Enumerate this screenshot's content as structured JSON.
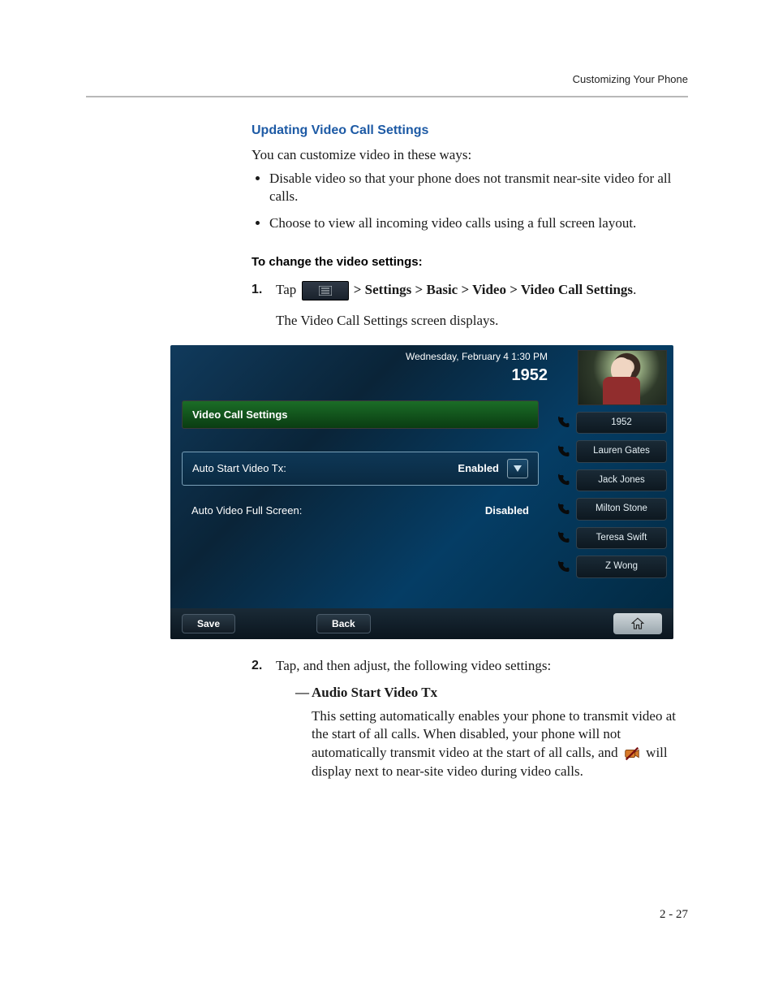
{
  "header": {
    "running": "Customizing Your Phone"
  },
  "section": {
    "title": "Updating Video Call Settings",
    "intro": "You can customize video in these ways:",
    "bullets": [
      "Disable video so that your phone does not transmit near-site video for all calls.",
      "Choose to view all incoming video calls using a full screen layout."
    ],
    "subTitle": "To change the video settings:",
    "step1_prefix": "Tap ",
    "step1_suffix_bold": "  > Settings > Basic > Video > Video Call Settings",
    "step1_period": ".",
    "step1_after": "The Video Call Settings screen displays.",
    "step2_intro": "Tap, and then adjust, the following video settings:",
    "step2_sub_bold": "Audio Start Video Tx",
    "step2_sub_body_1": "This setting automatically enables your phone to transmit video at the start of all calls. When disabled, your phone will not automatically transmit video at the start of all calls, and ",
    "step2_sub_body_2": " will display next to near-site video during video calls."
  },
  "phone": {
    "date": "Wednesday, February 4  1:30 PM",
    "extension": "1952",
    "panelTitle": "Video Call Settings",
    "settings": [
      {
        "label": "Auto Start Video Tx:",
        "value": "Enabled",
        "selected": true,
        "hasDropdown": true
      },
      {
        "label": "Auto Video Full Screen:",
        "value": "Disabled",
        "selected": false,
        "hasDropdown": false
      }
    ],
    "softkeys": {
      "save": "Save",
      "back": "Back"
    },
    "contacts": [
      "1952",
      "Lauren Gates",
      "Jack Jones",
      "Milton Stone",
      "Teresa Swift",
      "Z Wong"
    ]
  },
  "footer": {
    "pageNumber": "2 - 27"
  }
}
